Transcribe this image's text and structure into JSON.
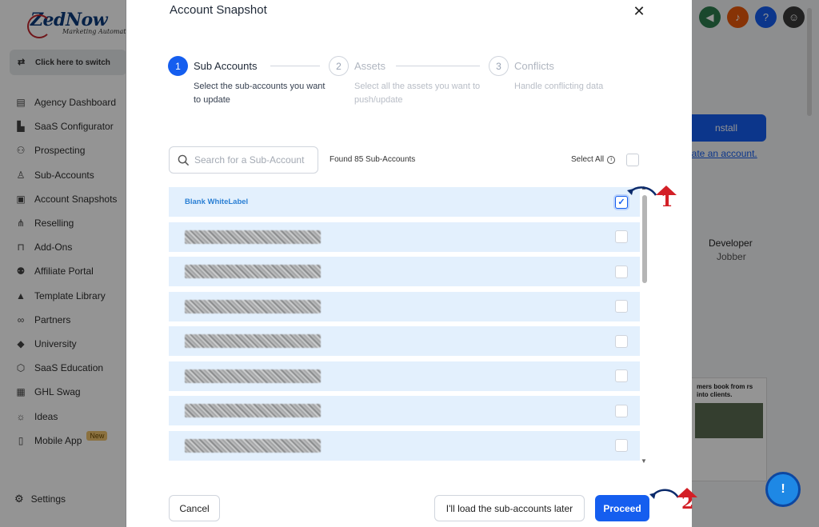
{
  "sidebar": {
    "logo": {
      "brand": "ZedNow",
      "tagline": "Marketing Automation"
    },
    "switcher_label": "Click here to switch",
    "items": [
      {
        "label": "Agency Dashboard",
        "icon": "dashboard-icon",
        "glyph": "▤"
      },
      {
        "label": "SaaS Configurator",
        "icon": "chart-icon",
        "glyph": "▙"
      },
      {
        "label": "Prospecting",
        "icon": "people-search-icon",
        "glyph": "⚇"
      },
      {
        "label": "Sub-Accounts",
        "icon": "user-icon",
        "glyph": "♙"
      },
      {
        "label": "Account Snapshots",
        "icon": "snapshot-icon",
        "glyph": "▣"
      },
      {
        "label": "Reselling",
        "icon": "sitemap-icon",
        "glyph": "⋔"
      },
      {
        "label": "Add-Ons",
        "icon": "bag-icon",
        "glyph": "⊓"
      },
      {
        "label": "Affiliate Portal",
        "icon": "users-icon",
        "glyph": "⚉"
      },
      {
        "label": "Template Library",
        "icon": "shapes-icon",
        "glyph": "▲"
      },
      {
        "label": "Partners",
        "icon": "handshake-icon",
        "glyph": "∞"
      },
      {
        "label": "University",
        "icon": "graduation-cap-icon",
        "glyph": "◆"
      },
      {
        "label": "SaaS Education",
        "icon": "cube-icon",
        "glyph": "⬡"
      },
      {
        "label": "GHL Swag",
        "icon": "storefront-icon",
        "glyph": "▦"
      },
      {
        "label": "Ideas",
        "icon": "lightbulb-icon",
        "glyph": "☼"
      },
      {
        "label": "Mobile App",
        "icon": "mobile-icon",
        "glyph": "▯",
        "badge": "New"
      }
    ],
    "settings_label": "Settings"
  },
  "background": {
    "install_label": "nstall",
    "create_account_link": "eate an account.",
    "developer_label": "Developer",
    "developer_name": "Jobber",
    "promo_text": "mers book from rs into clients."
  },
  "topbar": {
    "icons": [
      {
        "name": "megaphone-icon",
        "color": "#2e7d4f",
        "glyph": "◀"
      },
      {
        "name": "bell-icon",
        "color": "#e8590c",
        "glyph": "♪"
      },
      {
        "name": "help-icon",
        "color": "#155eef",
        "glyph": "?"
      },
      {
        "name": "avatar",
        "color": "#3a3a3a",
        "glyph": "☺"
      }
    ]
  },
  "modal": {
    "title": "Account Snapshot",
    "close_symbol": "✕",
    "steps": [
      {
        "number": "1",
        "name": "Sub Accounts",
        "description": "Select the sub-accounts you want to update",
        "active": true
      },
      {
        "number": "2",
        "name": "Assets",
        "description": "Select all the assets you want to push/update",
        "active": false
      },
      {
        "number": "3",
        "name": "Conflicts",
        "description": "Handle conflicting data",
        "active": false
      }
    ],
    "search": {
      "placeholder": "Search for a Sub-Account",
      "value": ""
    },
    "found_text": "Found 85 Sub-Accounts",
    "select_all_label": "Select All",
    "rows": [
      {
        "label": "Blank WhiteLabel",
        "checked": true,
        "redacted": false
      },
      {
        "label": "",
        "checked": false,
        "redacted": true
      },
      {
        "label": "",
        "checked": false,
        "redacted": true
      },
      {
        "label": "",
        "checked": false,
        "redacted": true
      },
      {
        "label": "",
        "checked": false,
        "redacted": true
      },
      {
        "label": "",
        "checked": false,
        "redacted": true
      },
      {
        "label": "",
        "checked": false,
        "redacted": true
      },
      {
        "label": "",
        "checked": false,
        "redacted": true
      }
    ],
    "buttons": {
      "cancel": "Cancel",
      "load_later": "I'll load the sub-accounts later",
      "proceed": "Proceed"
    }
  },
  "annotations": [
    {
      "number": "1"
    },
    {
      "number": "2"
    }
  ],
  "colors": {
    "primary": "#155eef",
    "row_bg": "#e3f0fd",
    "annotation": "#d31f26"
  }
}
